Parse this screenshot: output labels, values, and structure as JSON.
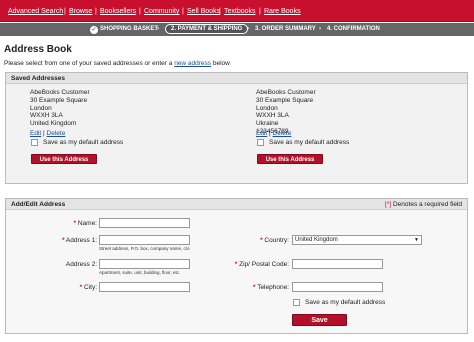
{
  "nav": {
    "items": [
      "Advanced Search",
      "Browse",
      "Booksellers",
      "Community",
      "Sell Books",
      "Textbooks",
      "Rare Books"
    ]
  },
  "steps": {
    "step1": "SHOPPING BASKET",
    "step2": "2. PAYMENT & SHIPPING",
    "step3": "3. ORDER SUMMARY",
    "step4": "4. CONFIRMATION"
  },
  "page": {
    "title": "Address Book",
    "intro_before": "Please select from one of your saved addresses or enter a ",
    "intro_link": "new address",
    "intro_after": " below"
  },
  "saved": {
    "heading": "Saved Addresses",
    "addresses": [
      {
        "lines": [
          "AbeBooks Customer",
          "30 Example Square",
          "London",
          "WXXH 3LA",
          "United Kingdom"
        ],
        "edit": "Edit",
        "sep": "|",
        "delete": "Delete",
        "default_label": "Save as my default address",
        "use_button": "Use this Address"
      },
      {
        "lines": [
          "AbeBooks Customer",
          "30 Example Square",
          "London",
          "WXXH 3LA",
          "Ukraine",
          "123456789"
        ],
        "edit": "Edit",
        "sep": "|",
        "delete": "Delete",
        "default_label": "Save as my default address",
        "use_button": "Use this Address"
      }
    ]
  },
  "form": {
    "heading": "Add/Edit Address",
    "required_note_star": "[*]",
    "required_note": " Denotes a required field",
    "star": "*",
    "name_label": "Name:",
    "address1_label": "Address 1:",
    "address1_hint": "Street address, P.O. box, company name, c/o",
    "address2_label": "Address 2:",
    "address2_hint": "Apartment, suite, unit, building, floor, etc.",
    "city_label": "City:",
    "country_label": "Country:",
    "country_value": "United Kingdom",
    "zip_label": "Zip/ Postal Code:",
    "phone_label": "Telephone:",
    "default_label": "Save as my default address",
    "save_button": "Save"
  },
  "colors": {
    "brand_red": "#c8102e",
    "link_blue": "#1a4fa0"
  }
}
